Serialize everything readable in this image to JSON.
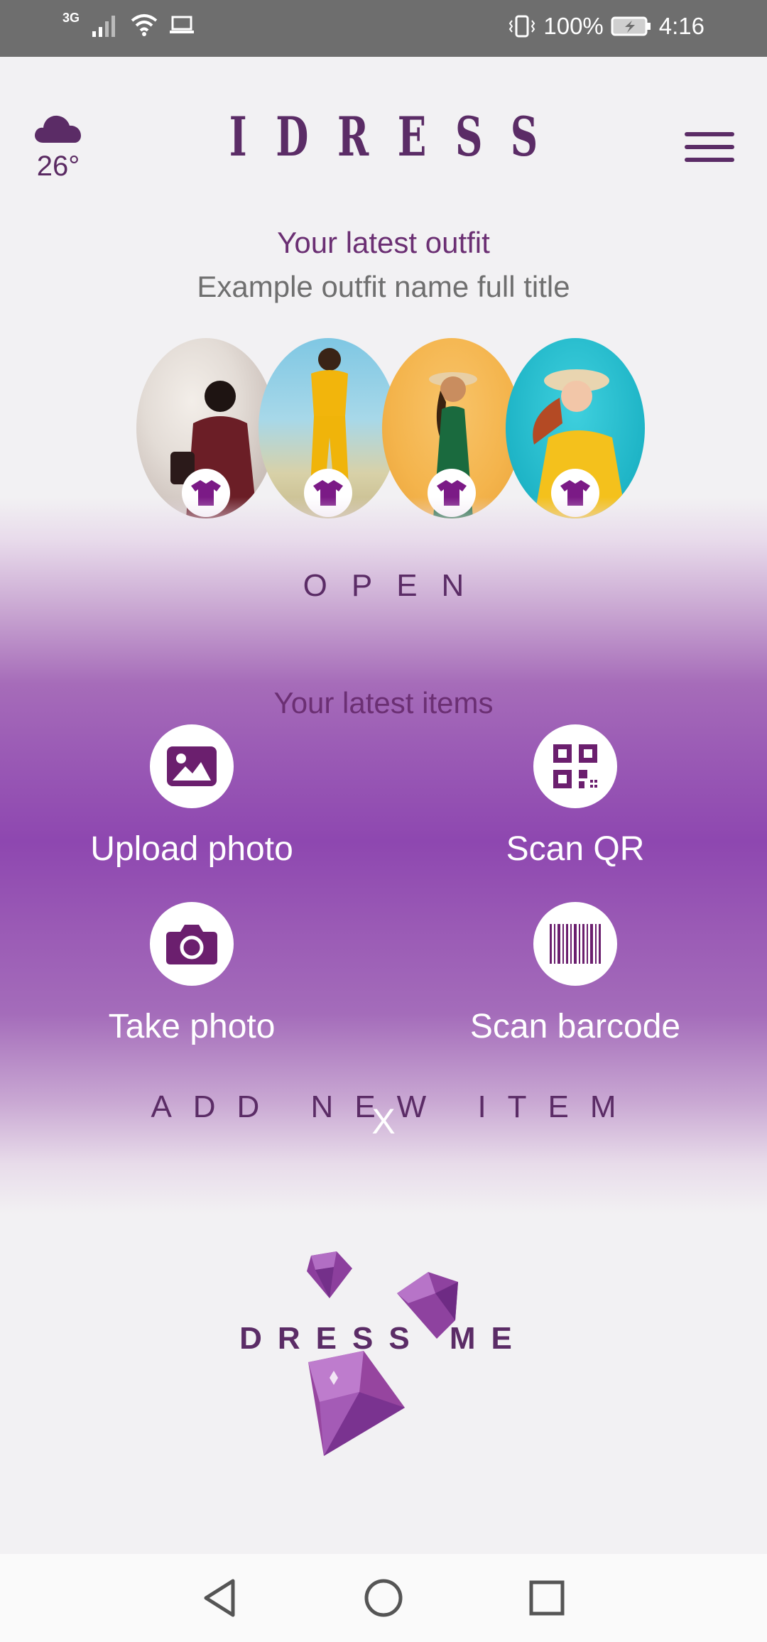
{
  "status_bar": {
    "network_type": "3G",
    "battery": "100%",
    "time": "4:16"
  },
  "header": {
    "weather_icon": "cloud-icon",
    "temperature": "26°",
    "brand": "IDRESS",
    "menu_icon": "hamburger-menu-icon"
  },
  "outfit": {
    "section_title": "Your latest outfit",
    "name": "Example outfit name full title",
    "open_label": "OPEN",
    "photo_icon": "tshirt-icon"
  },
  "items": {
    "section_title": "Your latest items",
    "actions": [
      {
        "label": "Upload photo",
        "icon": "image-icon"
      },
      {
        "label": "Scan QR",
        "icon": "qr-code-icon"
      },
      {
        "label": "Take photo",
        "icon": "camera-icon"
      },
      {
        "label": "Scan barcode",
        "icon": "barcode-icon"
      }
    ],
    "add_label": "ADD NEW ITEM",
    "close_label": "X"
  },
  "logo": {
    "word": "DRESS ME"
  },
  "nav": {
    "back_icon": "back-triangle-icon",
    "home_icon": "home-circle-icon",
    "recents_icon": "recents-square-icon"
  },
  "colors": {
    "brand_purple": "#5b2c66",
    "band_purple": "#8e47b0",
    "icon_purple": "#6b1f6e"
  }
}
